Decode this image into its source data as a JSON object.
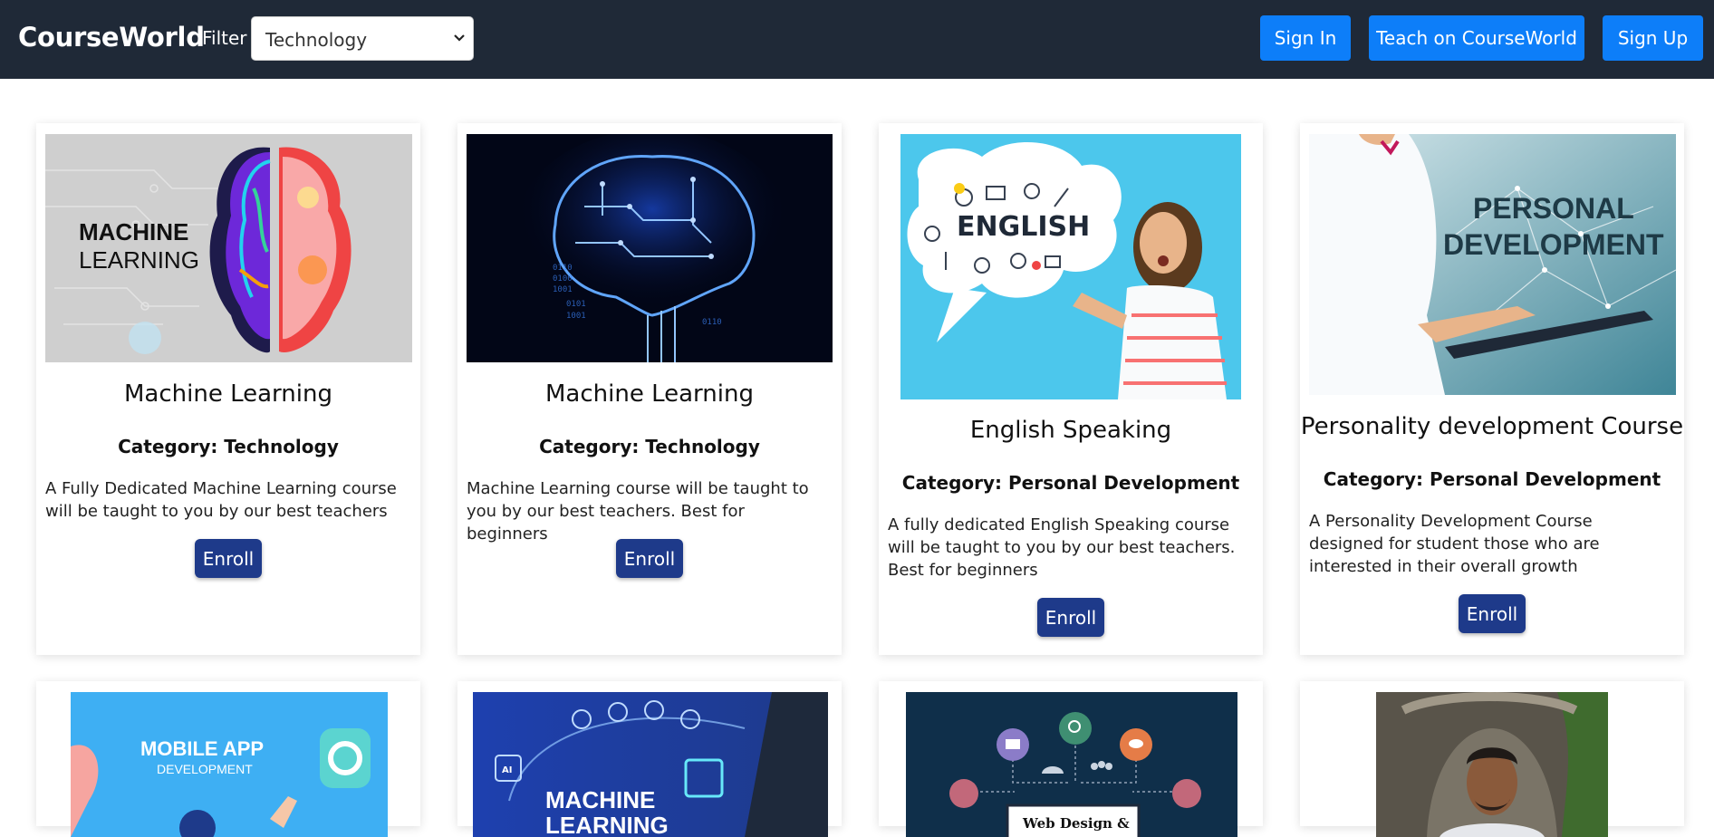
{
  "navbar": {
    "brand": "CourseWorld",
    "filter_label": "Filter",
    "filter_value": "Technology",
    "sign_in": "Sign In",
    "teach": "Teach on CourseWorld",
    "sign_up": "Sign Up"
  },
  "courses": [
    {
      "title": "Machine Learning",
      "category": "Category: Technology",
      "description": "A Fully Dedicated Machine Learning course will be taught to you by our best teachers",
      "enroll": "Enroll",
      "image_text": [
        "MACHINE",
        "LEARNING"
      ]
    },
    {
      "title": "Machine Learning",
      "category": "Category: Technology",
      "description": "Machine Learning course will be taught to you by our best teachers. Best for beginners",
      "enroll": "Enroll"
    },
    {
      "title": "English Speaking",
      "category": "Category: Personal Development",
      "description": "A fully dedicated English Speaking course will be taught to you by our best teachers. Best for beginners",
      "enroll": "Enroll",
      "image_text": [
        "ENGLISH"
      ]
    },
    {
      "title": "Personality development Course",
      "category": "Category: Personal Development",
      "description": "A Personality Development Course designed for student those who are interested in their overall growth",
      "enroll": "Enroll",
      "image_text": [
        "PERSONAL",
        "DEVELOPMENT"
      ]
    }
  ],
  "partial_courses": [
    {
      "image_text": [
        "MOBILE APP",
        "DEVELOPMENT"
      ]
    },
    {
      "image_text": [
        "MACHINE",
        "LEARNING"
      ]
    },
    {
      "image_text": [
        "Web Design &"
      ]
    },
    {
      "image_text": []
    }
  ]
}
